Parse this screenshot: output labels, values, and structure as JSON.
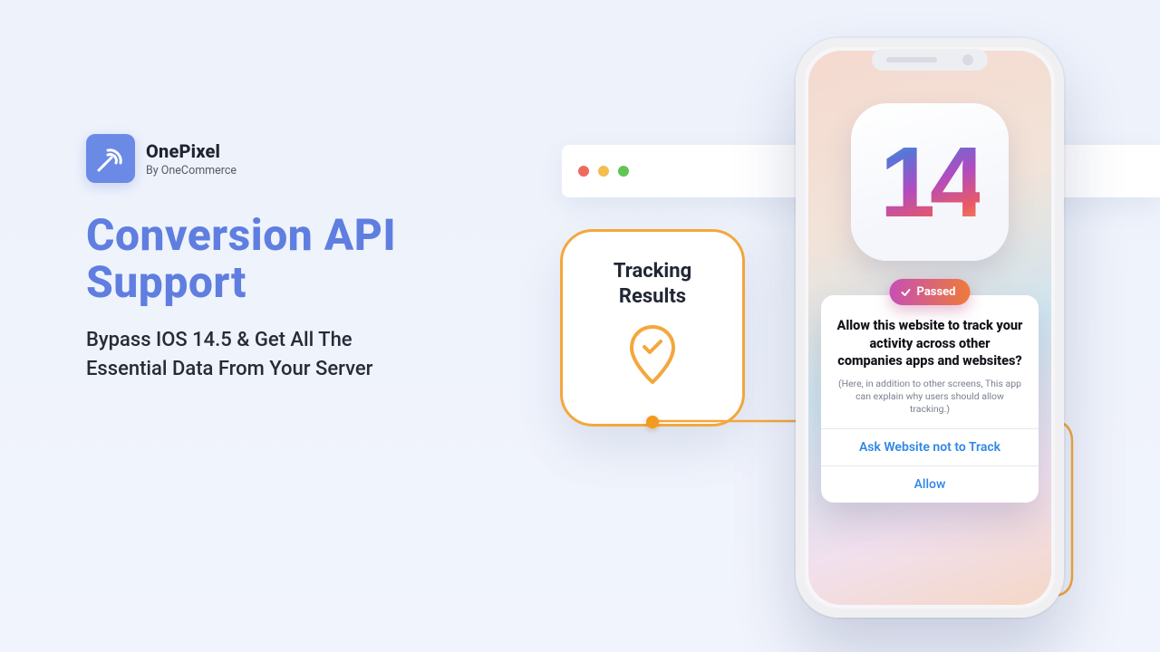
{
  "brand": {
    "name": "OnePixel",
    "by": "By OneCommerce"
  },
  "headline_l1": "Conversion API",
  "headline_l2": "Support",
  "sub_l1": "Bypass IOS 14.5 & Get All The",
  "sub_l2": "Essential Data From Your Server",
  "track": {
    "title_l1": "Tracking",
    "title_l2": "Results"
  },
  "ios_label": "14",
  "passed_label": "Passed",
  "prompt": {
    "title": "Allow this website to track your activity across other companies apps and websites?",
    "subtitle": "(Here, in addition to other screens, This app can explain why users should allow tracking.)",
    "deny": "Ask Website not to Track",
    "allow": "Allow"
  },
  "colors": {
    "accent_blue": "#5f7ee0",
    "accent_orange": "#f4a73c"
  }
}
